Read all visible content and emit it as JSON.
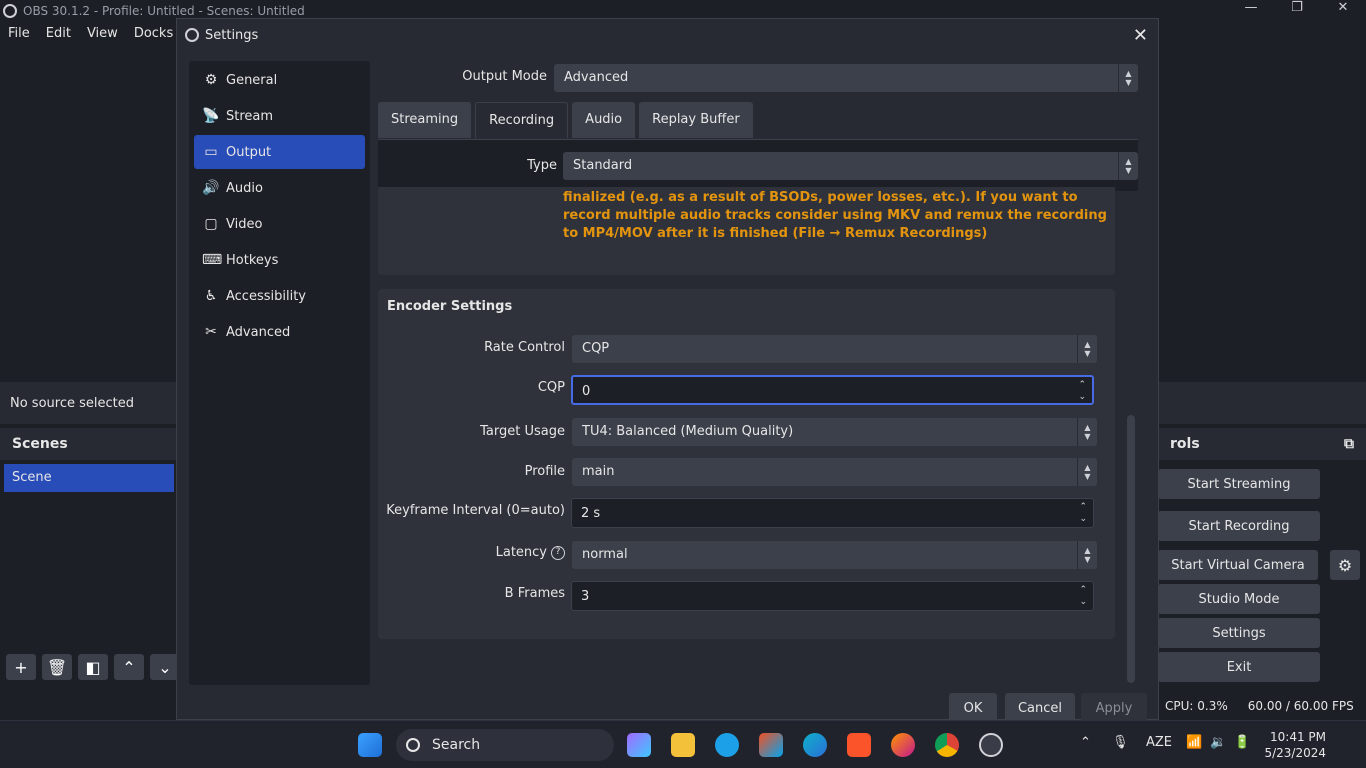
{
  "app": {
    "title": "OBS 30.1.2 - Profile: Untitled - Scenes: Untitled",
    "menu": [
      "File",
      "Edit",
      "View",
      "Docks"
    ],
    "no_source": "No source selected",
    "scenes_title": "Scenes",
    "scenes": [
      "Scene"
    ],
    "controls_title": "rols",
    "controls": {
      "start_streaming": "Start Streaming",
      "start_recording": "Start Recording",
      "start_virtual_camera": "Start Virtual Camera",
      "studio_mode": "Studio Mode",
      "settings": "Settings",
      "exit": "Exit"
    },
    "status": {
      "cpu": "CPU: 0.3%",
      "fps": "60.00 / 60.00 FPS"
    }
  },
  "dialog": {
    "title": "Settings",
    "nav": [
      {
        "label": "General",
        "icon": "gear-icon"
      },
      {
        "label": "Stream",
        "icon": "antenna-icon"
      },
      {
        "label": "Output",
        "icon": "output-icon"
      },
      {
        "label": "Audio",
        "icon": "speaker-icon"
      },
      {
        "label": "Video",
        "icon": "monitor-icon"
      },
      {
        "label": "Hotkeys",
        "icon": "keyboard-icon"
      },
      {
        "label": "Accessibility",
        "icon": "accessibility-icon"
      },
      {
        "label": "Advanced",
        "icon": "tools-icon"
      }
    ],
    "active_nav": "Output",
    "output_mode_label": "Output Mode",
    "output_mode_value": "Advanced",
    "tabs": [
      "Streaming",
      "Recording",
      "Audio",
      "Replay Buffer"
    ],
    "active_tab": "Recording",
    "type_label": "Type",
    "type_value": "Standard",
    "warning": "finalized (e.g. as a result of BSODs, power losses, etc.). If you want to record multiple audio tracks consider using MKV and remux the recording to MP4/MOV after it is finished (File → Remux Recordings)",
    "encoder_title": "Encoder Settings",
    "fields": {
      "rate_control": {
        "label": "Rate Control",
        "value": "CQP"
      },
      "cqp": {
        "label": "CQP",
        "value": "0"
      },
      "target_usage": {
        "label": "Target Usage",
        "value": "TU4: Balanced (Medium Quality)"
      },
      "profile": {
        "label": "Profile",
        "value": "main"
      },
      "keyframe": {
        "label": "Keyframe Interval (0=auto)",
        "value": "2 s"
      },
      "latency": {
        "label": "Latency",
        "value": "normal"
      },
      "bframes": {
        "label": "B Frames",
        "value": "3"
      }
    },
    "buttons": {
      "ok": "OK",
      "cancel": "Cancel",
      "apply": "Apply"
    }
  },
  "taskbar": {
    "search": "Search",
    "language": "AZE",
    "time": "10:41 PM",
    "date": "5/23/2024"
  },
  "colors": {
    "accent": "#284cb8",
    "warning": "#e3940e",
    "focus": "#476be5"
  }
}
